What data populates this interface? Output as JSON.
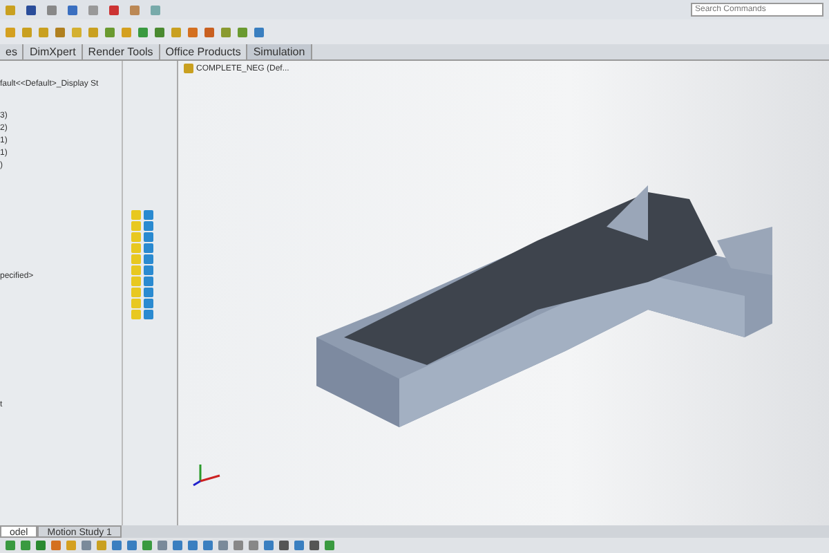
{
  "search": {
    "placeholder": "Search Commands"
  },
  "command_tabs": [
    {
      "label": "es",
      "selected": false
    },
    {
      "label": "DimXpert",
      "selected": false
    },
    {
      "label": "Render Tools",
      "selected": false
    },
    {
      "label": "Office Products",
      "selected": false
    },
    {
      "label": "Simulation",
      "selected": true
    }
  ],
  "feature_tree": {
    "header": "fault<<Default>_Display St",
    "items": [
      "3)",
      "2)",
      "1)",
      "1)",
      ")"
    ],
    "lower_items": [
      "pecified>",
      "t"
    ]
  },
  "document": {
    "title": "COMPLETE_NEG  (Def..."
  },
  "bottom_tabs": [
    {
      "label": "odel",
      "selected": true
    },
    {
      "label": "Motion Study 1",
      "selected": false
    }
  ]
}
